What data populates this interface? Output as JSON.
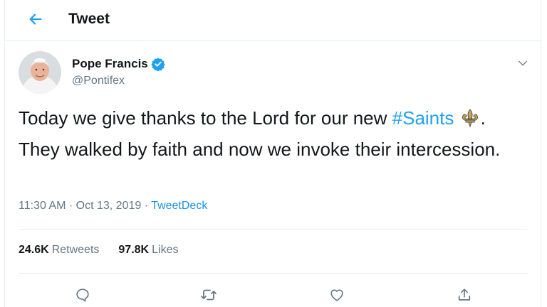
{
  "header": {
    "back_icon": "arrow-left-icon",
    "title": "Tweet"
  },
  "tweet": {
    "author": {
      "name": "Pope Francis",
      "handle": "@Pontifex",
      "verified": true
    },
    "text_before": "Today we give thanks to the Lord for our new ",
    "hashtag": "#Saints",
    "text_after": ". They walked by faith and now we invoke their intercession.",
    "timestamp": "11:30 AM · Oct 13, 2019 · ",
    "source": "TweetDeck"
  },
  "stats": {
    "retweets_count": "24.6K",
    "retweets_label": "Retweets",
    "likes_count": "97.8K",
    "likes_label": "Likes"
  },
  "actions": [
    "reply-icon",
    "retweet-icon",
    "like-icon",
    "share-icon"
  ],
  "colors": {
    "accent": "#1da1f2",
    "link": "#1b95e0",
    "secondary_text": "#657786",
    "border": "#e6ecf0"
  }
}
